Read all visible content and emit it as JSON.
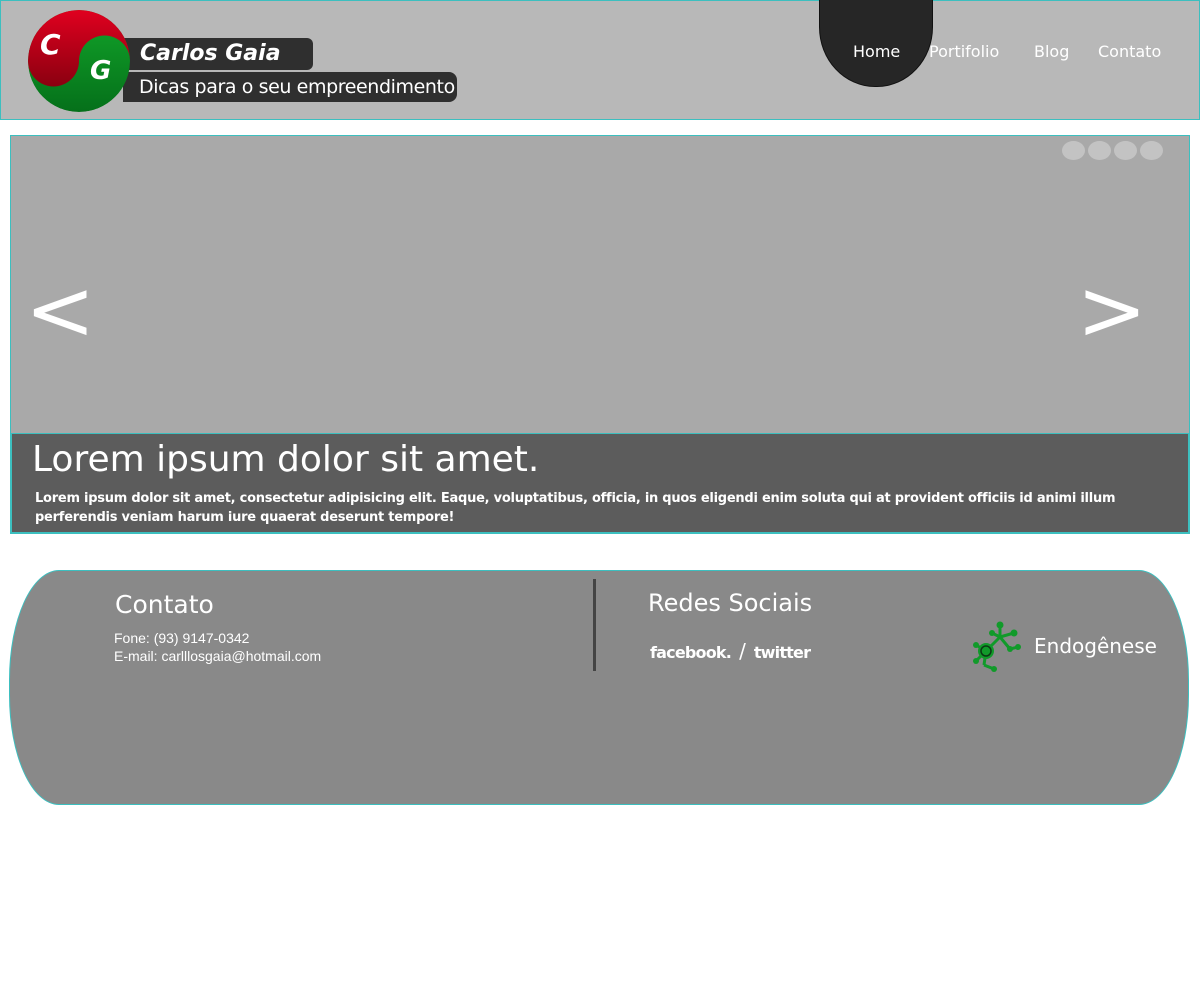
{
  "header": {
    "logo_letter_1": "C",
    "logo_letter_2": "G",
    "site_name": "Carlos Gaia",
    "tagline": "Dicas para o seu empreendimento",
    "nav": [
      {
        "label": "Home",
        "active": true
      },
      {
        "label": "Portifolio",
        "active": false
      },
      {
        "label": "Blog",
        "active": false
      },
      {
        "label": "Contato",
        "active": false
      }
    ]
  },
  "slider": {
    "prev_label": "<",
    "next_label": ">",
    "slide_count": 4,
    "caption_title": "Lorem ipsum dolor sit amet.",
    "caption_text": "Lorem ipsum dolor sit amet, consectetur adipisicing elit. Eaque, voluptatibus, officia, in quos eligendi enim soluta qui at provident officiis id animi illum perferendis veniam harum iure quaerat deserunt tempore!"
  },
  "footer": {
    "contato_title": "Contato",
    "phone": "Fone: (93) 9147-0342",
    "email": "E-mail: carlllosgaia@hotmail.com",
    "redes_title": "Redes Sociais",
    "facebook_label": "facebook.",
    "separator": "/",
    "twitter_label": "twitter",
    "brand_name": "Endogênese"
  },
  "colors": {
    "header_bg": "#b8b8b8",
    "accent_border": "#3cbfbf",
    "logo_red": "#c0001a",
    "logo_green": "#0a8a1a",
    "slider_bg": "#a9a9a9",
    "caption_bg": "#5c5c5c",
    "footer_bg": "#898989"
  }
}
